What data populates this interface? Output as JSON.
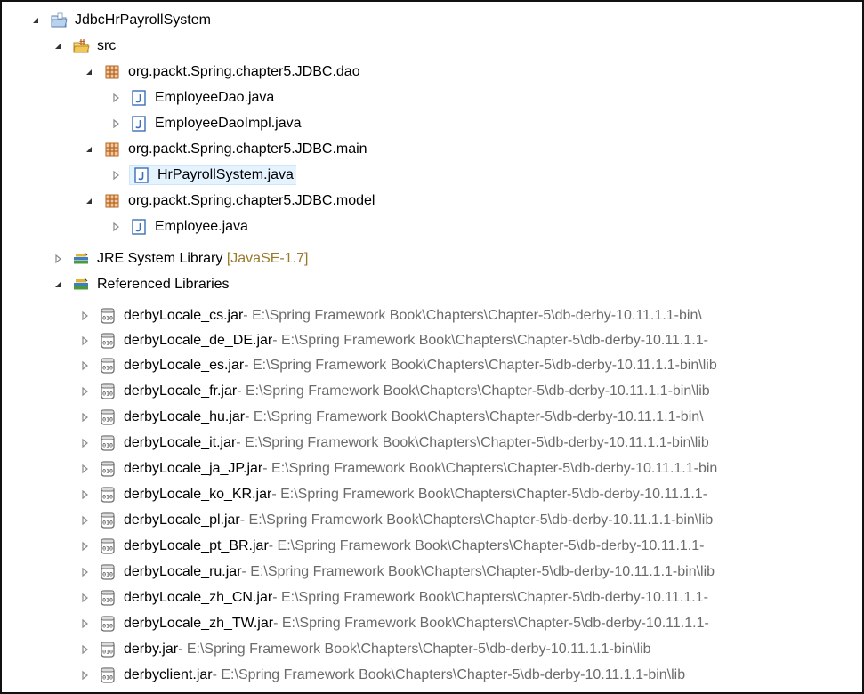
{
  "tree": {
    "project": {
      "label": "JdbcHrPayrollSystem"
    },
    "src": {
      "label": "src"
    },
    "packages": [
      {
        "label": "org.packt.Spring.chapter5.JDBC.dao",
        "files": [
          {
            "label": "EmployeeDao.java"
          },
          {
            "label": "EmployeeDaoImpl.java"
          }
        ]
      },
      {
        "label": "org.packt.Spring.chapter5.JDBC.main",
        "files": [
          {
            "label": "HrPayrollSystem.java"
          }
        ]
      },
      {
        "label": "org.packt.Spring.chapter5.JDBC.model",
        "files": [
          {
            "label": "Employee.java"
          }
        ]
      }
    ],
    "jre": {
      "label": "JRE System Library",
      "decoration": "[JavaSE-1.7]"
    },
    "referenced": {
      "label": "Referenced Libraries"
    },
    "jars": [
      {
        "name": "derbyLocale_cs.jar",
        "path": " - E:\\Spring Framework Book\\Chapters\\Chapter-5\\db-derby-10.11.1.1-bin\\"
      },
      {
        "name": "derbyLocale_de_DE.jar",
        "path": " - E:\\Spring Framework Book\\Chapters\\Chapter-5\\db-derby-10.11.1.1-"
      },
      {
        "name": "derbyLocale_es.jar",
        "path": " - E:\\Spring Framework Book\\Chapters\\Chapter-5\\db-derby-10.11.1.1-bin\\lib"
      },
      {
        "name": "derbyLocale_fr.jar",
        "path": " - E:\\Spring Framework Book\\Chapters\\Chapter-5\\db-derby-10.11.1.1-bin\\lib"
      },
      {
        "name": "derbyLocale_hu.jar",
        "path": " - E:\\Spring Framework Book\\Chapters\\Chapter-5\\db-derby-10.11.1.1-bin\\"
      },
      {
        "name": "derbyLocale_it.jar",
        "path": " - E:\\Spring Framework Book\\Chapters\\Chapter-5\\db-derby-10.11.1.1-bin\\lib"
      },
      {
        "name": "derbyLocale_ja_JP.jar",
        "path": " - E:\\Spring Framework Book\\Chapters\\Chapter-5\\db-derby-10.11.1.1-bin"
      },
      {
        "name": "derbyLocale_ko_KR.jar",
        "path": " - E:\\Spring Framework Book\\Chapters\\Chapter-5\\db-derby-10.11.1.1-"
      },
      {
        "name": "derbyLocale_pl.jar",
        "path": " - E:\\Spring Framework Book\\Chapters\\Chapter-5\\db-derby-10.11.1.1-bin\\lib"
      },
      {
        "name": "derbyLocale_pt_BR.jar",
        "path": " - E:\\Spring Framework Book\\Chapters\\Chapter-5\\db-derby-10.11.1.1-"
      },
      {
        "name": "derbyLocale_ru.jar",
        "path": " - E:\\Spring Framework Book\\Chapters\\Chapter-5\\db-derby-10.11.1.1-bin\\lib"
      },
      {
        "name": "derbyLocale_zh_CN.jar",
        "path": " - E:\\Spring Framework Book\\Chapters\\Chapter-5\\db-derby-10.11.1.1-"
      },
      {
        "name": "derbyLocale_zh_TW.jar",
        "path": " - E:\\Spring Framework Book\\Chapters\\Chapter-5\\db-derby-10.11.1.1-"
      },
      {
        "name": "derby.jar",
        "path": " - E:\\Spring Framework Book\\Chapters\\Chapter-5\\db-derby-10.11.1.1-bin\\lib"
      },
      {
        "name": "derbyclient.jar",
        "path": " - E:\\Spring Framework Book\\Chapters\\Chapter-5\\db-derby-10.11.1.1-bin\\lib"
      }
    ]
  },
  "colors": {
    "selection": "#e5f3ff",
    "decoration": "#6b6b6b",
    "jre_decoration": "#9a7a2a",
    "package_icon": "#b5651d",
    "java_icon": "#3b6fb6"
  }
}
